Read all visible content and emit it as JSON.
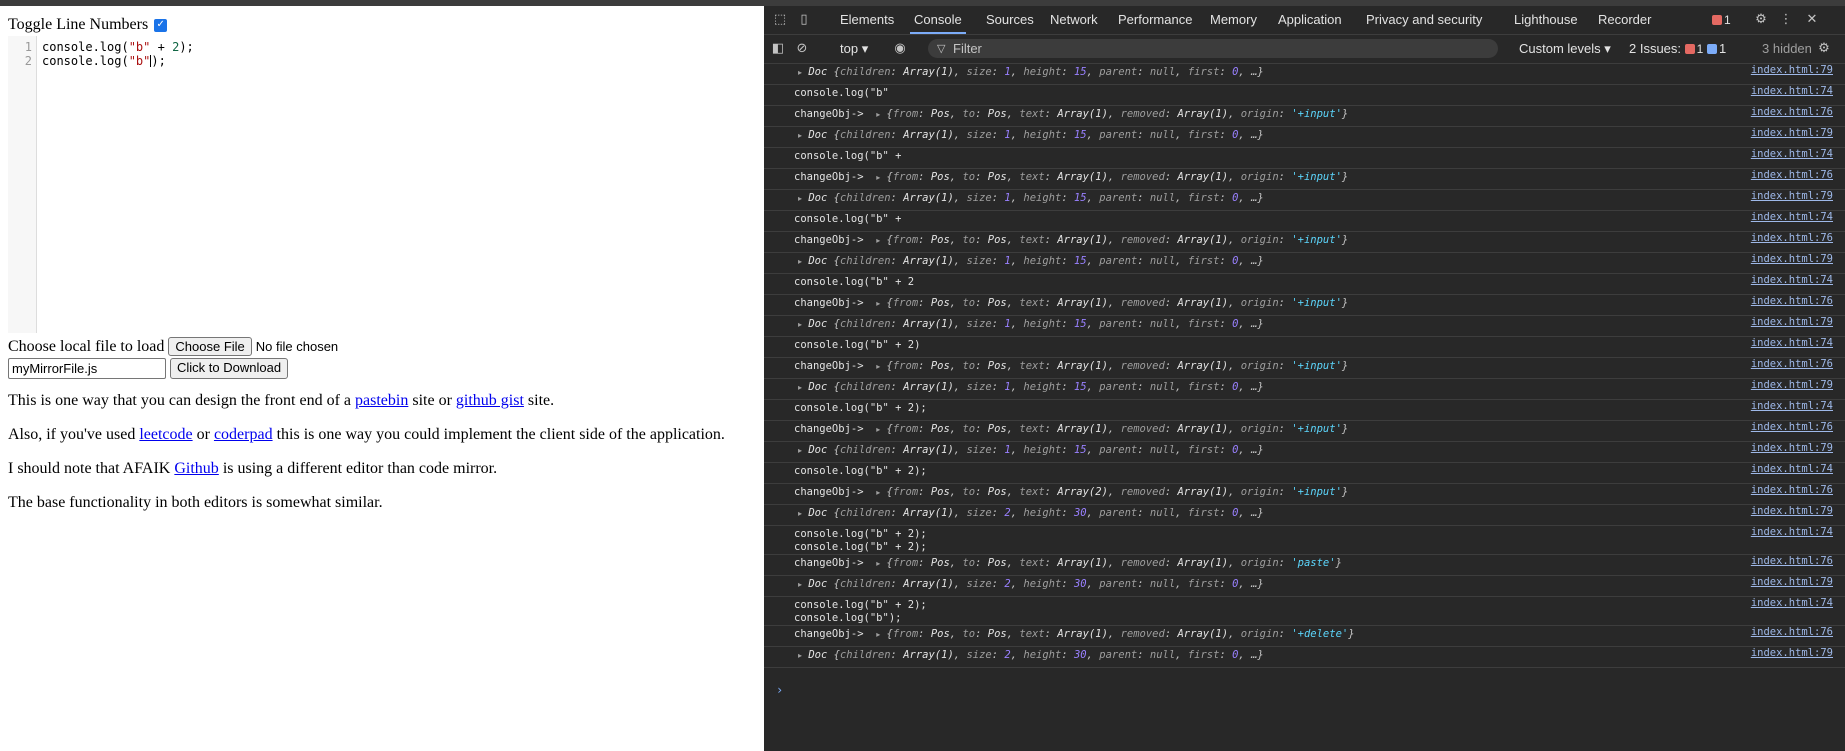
{
  "page": {
    "toggle_label": "Toggle Line Numbers",
    "editor_lines": [
      {
        "num": "1",
        "pre": "console.log(",
        "str": "\"b\"",
        "mid": " + ",
        "numv": "2",
        "post": ");"
      },
      {
        "num": "2",
        "pre": "console.log(",
        "str": "\"b\"",
        "mid": "",
        "numv": "",
        "post": ");"
      }
    ],
    "file_label": "Choose local file to load",
    "choose_button": "Choose File",
    "no_file": "No file chosen",
    "filename_value": "myMirrorFile.js",
    "download_button": "Click to Download",
    "para1": {
      "a": "This is one way that you can design the front end of a ",
      "l1": "pastebin",
      "b": " site or ",
      "l2": "github gist",
      "c": " site."
    },
    "para2": {
      "a": "Also, if you've used ",
      "l1": "leetcode",
      "b": " or ",
      "l2": "coderpad",
      "c": " this is one way you could implement the client side of the application."
    },
    "para3": {
      "a": "I should note that AFAIK ",
      "l1": "Github",
      "c": " is using a different editor than code mirror."
    },
    "para4": "The base functionality in both editors is somewhat similar."
  },
  "devtools": {
    "tabs": [
      "Elements",
      "Console",
      "Sources",
      "Network",
      "Performance",
      "Memory",
      "Application",
      "Privacy and security",
      "Lighthouse",
      "Recorder"
    ],
    "active_tab": "Console",
    "error_count": "1",
    "context": "top",
    "filter_placeholder": "Filter",
    "levels": "Custom levels",
    "issues_label": "2 Issues:",
    "issues_error": "1",
    "issues_info": "1",
    "hidden": "3 hidden",
    "doc1": "{children: Array(1), size: 1, height: 15, parent: null, first: 0, …}",
    "doc2": "{children: Array(1), size: 2, height: 30, parent: null, first: 0, …}",
    "rows": [
      {
        "type": "doc",
        "size": "1",
        "height": "15",
        "src": "index.html:79"
      },
      {
        "type": "log",
        "text": "console.log(\"b\"",
        "src": "index.html:74"
      },
      {
        "type": "change",
        "text": "Array(1)",
        "origin": "'+input'",
        "src": "index.html:76"
      },
      {
        "type": "doc",
        "size": "1",
        "height": "15",
        "src": "index.html:79"
      },
      {
        "type": "log",
        "text": "console.log(\"b\" +",
        "src": "index.html:74"
      },
      {
        "type": "change",
        "text": "Array(1)",
        "origin": "'+input'",
        "src": "index.html:76"
      },
      {
        "type": "doc",
        "size": "1",
        "height": "15",
        "src": "index.html:79"
      },
      {
        "type": "log",
        "text": "console.log(\"b\" +",
        "src": "index.html:74"
      },
      {
        "type": "change",
        "text": "Array(1)",
        "origin": "'+input'",
        "src": "index.html:76"
      },
      {
        "type": "doc",
        "size": "1",
        "height": "15",
        "src": "index.html:79"
      },
      {
        "type": "log",
        "text": "console.log(\"b\" + 2",
        "src": "index.html:74"
      },
      {
        "type": "change",
        "text": "Array(1)",
        "origin": "'+input'",
        "src": "index.html:76"
      },
      {
        "type": "doc",
        "size": "1",
        "height": "15",
        "src": "index.html:79"
      },
      {
        "type": "log",
        "text": "console.log(\"b\" + 2)",
        "src": "index.html:74"
      },
      {
        "type": "change",
        "text": "Array(1)",
        "origin": "'+input'",
        "src": "index.html:76"
      },
      {
        "type": "doc",
        "size": "1",
        "height": "15",
        "src": "index.html:79"
      },
      {
        "type": "log",
        "text": "console.log(\"b\" + 2);",
        "src": "index.html:74"
      },
      {
        "type": "change",
        "text": "Array(1)",
        "origin": "'+input'",
        "src": "index.html:76"
      },
      {
        "type": "doc",
        "size": "1",
        "height": "15",
        "src": "index.html:79"
      },
      {
        "type": "log",
        "text": "console.log(\"b\" + 2);",
        "src": "index.html:74"
      },
      {
        "type": "change",
        "text": "Array(2)",
        "origin": "'+input'",
        "src": "index.html:76"
      },
      {
        "type": "doc",
        "size": "2",
        "height": "30",
        "src": "index.html:79"
      },
      {
        "type": "log2",
        "text": "console.log(\"b\" + 2);",
        "text2": "console.log(\"b\" + 2);",
        "src": "index.html:74"
      },
      {
        "type": "change",
        "text": "Array(1)",
        "origin": "'paste'",
        "src": "index.html:76"
      },
      {
        "type": "doc",
        "size": "2",
        "height": "30",
        "src": "index.html:79"
      },
      {
        "type": "log2",
        "text": "console.log(\"b\" + 2);",
        "text2": "console.log(\"b\");",
        "src": "index.html:74"
      },
      {
        "type": "change",
        "text": "Array(1)",
        "origin": "'+delete'",
        "src": "index.html:76"
      },
      {
        "type": "doc",
        "size": "2",
        "height": "30",
        "src": "index.html:79"
      }
    ]
  }
}
